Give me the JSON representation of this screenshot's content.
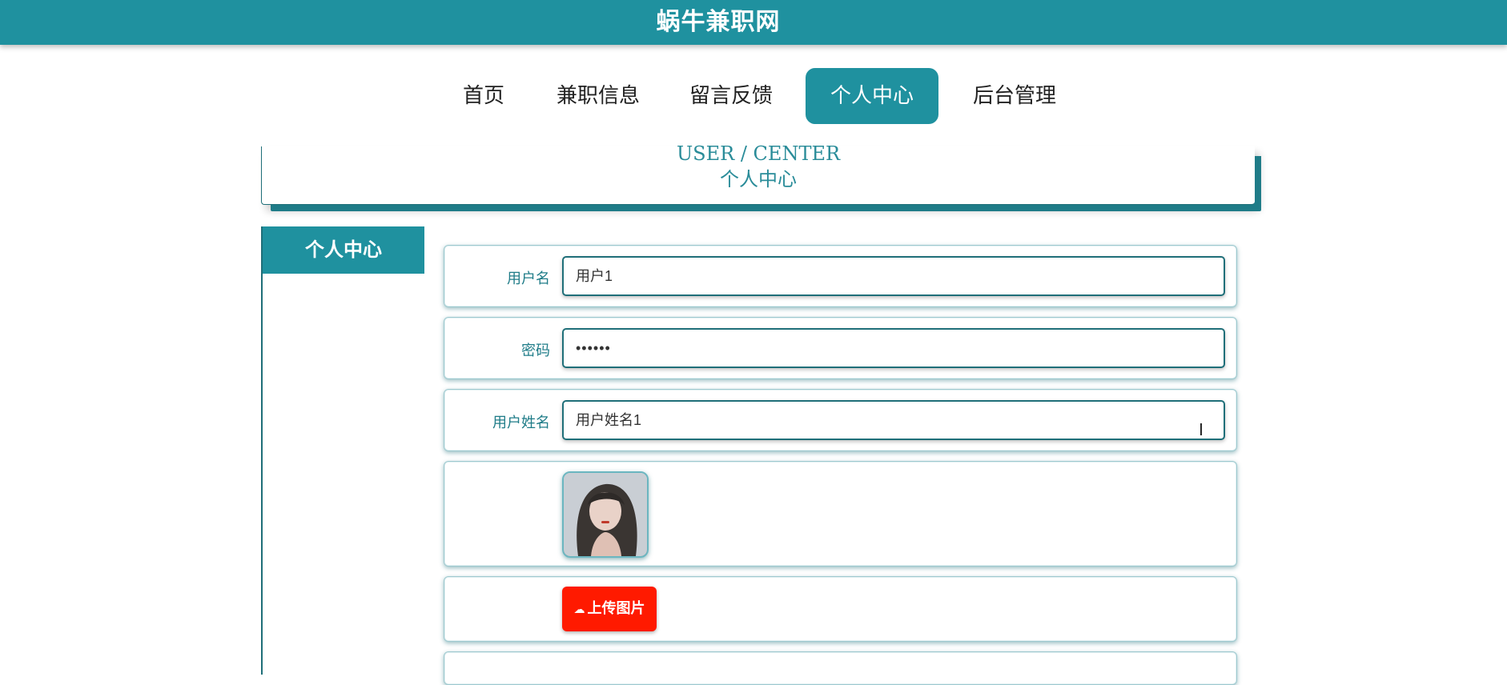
{
  "site": {
    "title": "蜗牛兼职网"
  },
  "nav": {
    "items": [
      "首页",
      "兼职信息",
      "留言反馈",
      "个人中心",
      "后台管理"
    ],
    "active_index": 3
  },
  "banner": {
    "en": "USER / CENTER",
    "cn": "个人中心"
  },
  "sidebar": {
    "title": "个人中心"
  },
  "form": {
    "username": {
      "label": "用户名",
      "value": "用户1"
    },
    "password": {
      "label": "密码",
      "value": "••••••"
    },
    "realname": {
      "label": "用户姓名",
      "value": "用户姓名1"
    },
    "avatar_icon": "user-photo",
    "upload": {
      "icon": "cloud-upload-icon",
      "label": "上传图片"
    }
  },
  "colors": {
    "primary": "#1f919f",
    "danger": "#ff1a00"
  }
}
